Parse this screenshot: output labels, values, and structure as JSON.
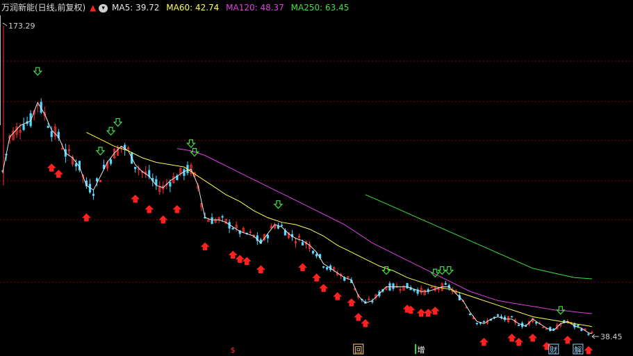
{
  "header": {
    "stock_title": "万润新能(日线,前复权)",
    "ma_items": [
      {
        "label": "MA5: 39.72",
        "color": "#e6e6e6"
      },
      {
        "label": "MA60: 42.74",
        "color": "#ffff50"
      },
      {
        "label": "MA120: 48.37",
        "color": "#e040e0"
      },
      {
        "label": "MA250: 63.45",
        "color": "#40e040"
      }
    ]
  },
  "chart_data": {
    "type": "line",
    "title": "",
    "xlabel": "",
    "ylabel": "",
    "ylim": [
      36,
      176
    ],
    "price_max_label": "173.29",
    "price_min_label": "38.45",
    "x_count": 170,
    "series": [
      {
        "name": "MA5",
        "color": "#e6e6e6",
        "points": [
          [
            0,
            110
          ],
          [
            2,
            125
          ],
          [
            5,
            130
          ],
          [
            8,
            132
          ],
          [
            10,
            140
          ],
          [
            12,
            135
          ],
          [
            14,
            128
          ],
          [
            16,
            125
          ],
          [
            18,
            118
          ],
          [
            20,
            116
          ],
          [
            22,
            112
          ],
          [
            24,
            104
          ],
          [
            26,
            102
          ],
          [
            28,
            108
          ],
          [
            30,
            114
          ],
          [
            32,
            118
          ],
          [
            34,
            121
          ],
          [
            36,
            119
          ],
          [
            38,
            113
          ],
          [
            40,
            110
          ],
          [
            42,
            108
          ],
          [
            44,
            104
          ],
          [
            46,
            103
          ],
          [
            48,
            106
          ],
          [
            50,
            108
          ],
          [
            52,
            110
          ],
          [
            54,
            111
          ],
          [
            56,
            104
          ],
          [
            58,
            90
          ],
          [
            60,
            89
          ],
          [
            62,
            89
          ],
          [
            64,
            88
          ],
          [
            66,
            86
          ],
          [
            68,
            84
          ],
          [
            70,
            83
          ],
          [
            72,
            82
          ],
          [
            74,
            79
          ],
          [
            76,
            83
          ],
          [
            78,
            87
          ],
          [
            80,
            86
          ],
          [
            82,
            83
          ],
          [
            84,
            81
          ],
          [
            86,
            80
          ],
          [
            88,
            78
          ],
          [
            90,
            75
          ],
          [
            92,
            70
          ],
          [
            94,
            68
          ],
          [
            96,
            66
          ],
          [
            98,
            64
          ],
          [
            100,
            63
          ],
          [
            102,
            56
          ],
          [
            104,
            53
          ],
          [
            106,
            54
          ],
          [
            108,
            57
          ],
          [
            110,
            60
          ],
          [
            112,
            60
          ],
          [
            114,
            60
          ],
          [
            116,
            60
          ],
          [
            118,
            59
          ],
          [
            120,
            58
          ],
          [
            122,
            58
          ],
          [
            124,
            59
          ],
          [
            126,
            60
          ],
          [
            128,
            60
          ],
          [
            130,
            57
          ],
          [
            132,
            54
          ],
          [
            134,
            49
          ],
          [
            136,
            45
          ],
          [
            138,
            44
          ],
          [
            140,
            46
          ],
          [
            142,
            47
          ],
          [
            144,
            46
          ],
          [
            146,
            46
          ],
          [
            148,
            44
          ],
          [
            150,
            43
          ],
          [
            152,
            46
          ],
          [
            154,
            44
          ],
          [
            156,
            42
          ],
          [
            158,
            41
          ],
          [
            160,
            44
          ],
          [
            162,
            45
          ],
          [
            164,
            43
          ],
          [
            166,
            42
          ],
          [
            168,
            40
          ],
          [
            169,
            39.72
          ]
        ]
      },
      {
        "name": "MA60",
        "color": "#ffff50",
        "points": [
          [
            24,
            127
          ],
          [
            28,
            124
          ],
          [
            32,
            121
          ],
          [
            36,
            119
          ],
          [
            40,
            116
          ],
          [
            44,
            114
          ],
          [
            48,
            113
          ],
          [
            52,
            112
          ],
          [
            56,
            108
          ],
          [
            60,
            104
          ],
          [
            64,
            100
          ],
          [
            68,
            97
          ],
          [
            72,
            93
          ],
          [
            76,
            90
          ],
          [
            80,
            88
          ],
          [
            84,
            87
          ],
          [
            88,
            85
          ],
          [
            92,
            82
          ],
          [
            96,
            78
          ],
          [
            100,
            75
          ],
          [
            104,
            72
          ],
          [
            108,
            69
          ],
          [
            112,
            67
          ],
          [
            116,
            64
          ],
          [
            120,
            62
          ],
          [
            124,
            60
          ],
          [
            128,
            59
          ],
          [
            132,
            57
          ],
          [
            136,
            55
          ],
          [
            140,
            53
          ],
          [
            144,
            51
          ],
          [
            148,
            49
          ],
          [
            152,
            47
          ],
          [
            156,
            46
          ],
          [
            160,
            45
          ],
          [
            164,
            44
          ],
          [
            168,
            43
          ],
          [
            169,
            42.74
          ]
        ]
      },
      {
        "name": "MA120",
        "color": "#e040e0",
        "points": [
          [
            50,
            120
          ],
          [
            54,
            119
          ],
          [
            58,
            117
          ],
          [
            62,
            114
          ],
          [
            66,
            111
          ],
          [
            70,
            108
          ],
          [
            74,
            105
          ],
          [
            78,
            102
          ],
          [
            82,
            99
          ],
          [
            86,
            96
          ],
          [
            90,
            93
          ],
          [
            94,
            90
          ],
          [
            98,
            87
          ],
          [
            102,
            83
          ],
          [
            106,
            79
          ],
          [
            110,
            76
          ],
          [
            114,
            73
          ],
          [
            118,
            70
          ],
          [
            122,
            67
          ],
          [
            126,
            64
          ],
          [
            130,
            61
          ],
          [
            134,
            58
          ],
          [
            138,
            56
          ],
          [
            142,
            54
          ],
          [
            146,
            53
          ],
          [
            150,
            52
          ],
          [
            154,
            51
          ],
          [
            158,
            50
          ],
          [
            162,
            49.5
          ],
          [
            166,
            48.8
          ],
          [
            169,
            48.37
          ]
        ]
      },
      {
        "name": "MA250",
        "color": "#40e040",
        "points": [
          [
            104,
            100
          ],
          [
            110,
            96
          ],
          [
            116,
            92
          ],
          [
            122,
            88
          ],
          [
            128,
            84
          ],
          [
            134,
            80
          ],
          [
            140,
            76
          ],
          [
            146,
            72
          ],
          [
            152,
            68
          ],
          [
            158,
            66
          ],
          [
            164,
            64
          ],
          [
            169,
            63.45
          ]
        ]
      }
    ],
    "buy_signal_x": [
      14,
      16,
      24,
      38,
      42,
      46,
      50,
      58,
      66,
      68,
      70,
      74,
      86,
      90,
      92,
      96,
      100,
      102,
      104,
      116,
      117,
      120,
      122,
      124,
      138,
      146,
      148,
      152,
      156,
      162,
      168
    ],
    "sell_signal_x": [
      10,
      28,
      31,
      33,
      54,
      55,
      79,
      110,
      124,
      126,
      128,
      160
    ],
    "bottom_markers": [
      {
        "label": "$",
        "x": 66,
        "color": "#ff3030",
        "boxed": false
      },
      {
        "label": "回",
        "x": 102,
        "color": "#ffd080",
        "boxed": true
      },
      {
        "label": "增",
        "x": 120,
        "color": "#ffffff",
        "boxed": false,
        "prefix_color": "#40e040"
      },
      {
        "label": "财",
        "x": 158,
        "color": "#8fd0ff",
        "boxed": true
      },
      {
        "label": "解",
        "x": 165,
        "color": "#8fd0ff",
        "boxed": true
      }
    ]
  }
}
